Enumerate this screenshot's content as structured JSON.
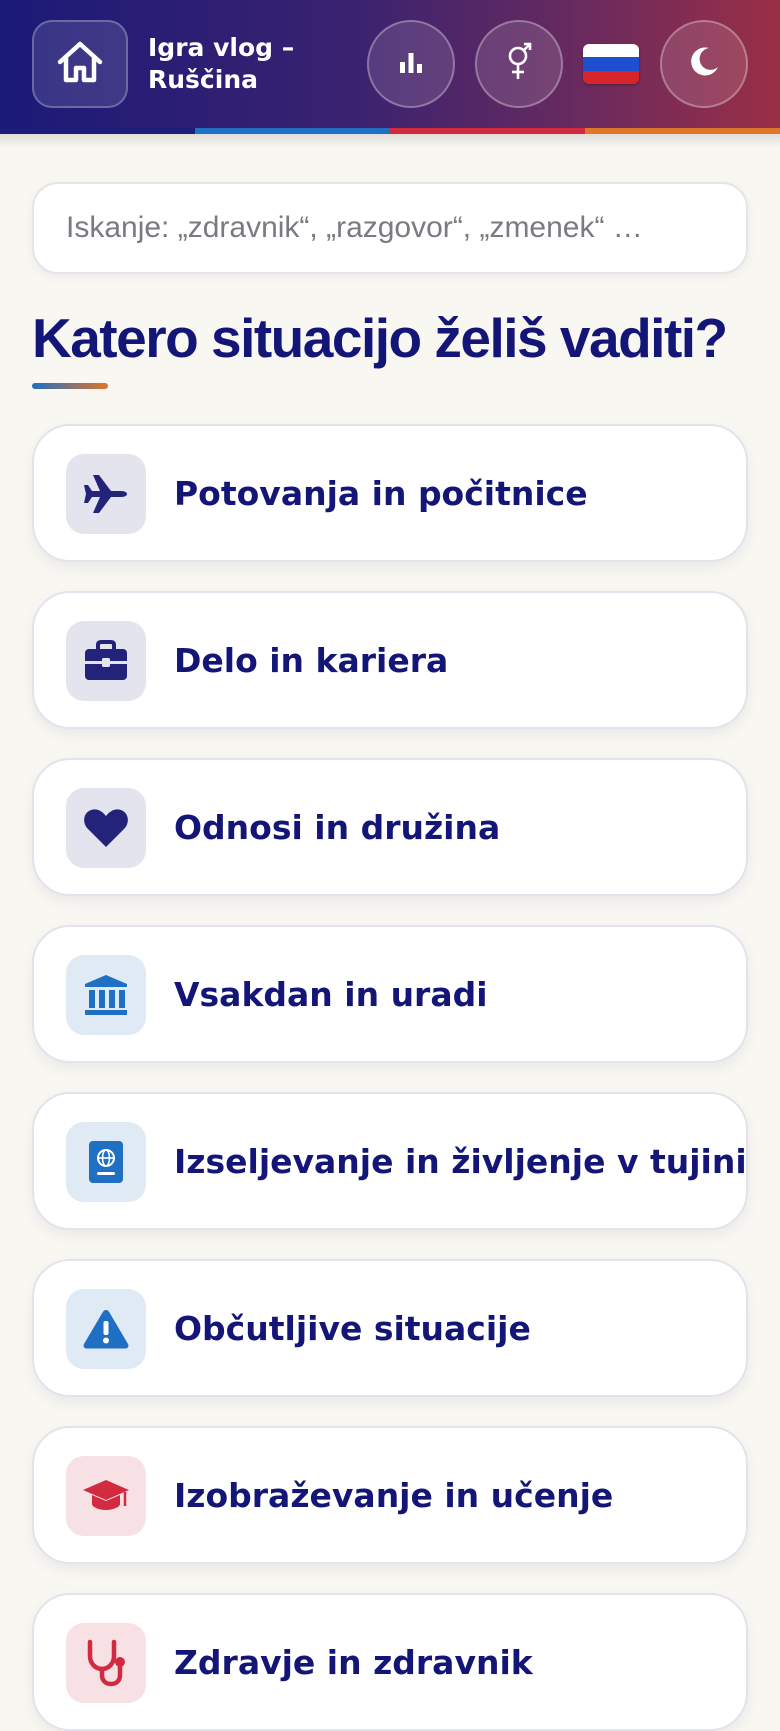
{
  "header": {
    "title": "Igra vlog – Ruščina",
    "buttons": {
      "home": "home-icon",
      "stats": "bar-chart-icon",
      "gender": "gender-icon",
      "language_flag": "russia-flag-icon",
      "theme": "moon-icon"
    },
    "stripe_colors": [
      "#1f1d7a",
      "#1f6fc2",
      "#d22b3f",
      "#e1762b"
    ]
  },
  "search": {
    "placeholder": "Iskanje: „zdravnik“, „razgovor“, „zmenek“ …",
    "value": ""
  },
  "main": {
    "heading": "Katero situacijo želiš vaditi?",
    "categories": [
      {
        "label": "Potovanja in počitnice",
        "icon": "airplane-icon",
        "icon_color": "#23237a",
        "icon_bg": "#e4e4ef"
      },
      {
        "label": "Delo in kariera",
        "icon": "briefcase-icon",
        "icon_color": "#23237a",
        "icon_bg": "#e4e4ef"
      },
      {
        "label": "Odnosi in družina",
        "icon": "heart-icon",
        "icon_color": "#23237a",
        "icon_bg": "#e4e4ef"
      },
      {
        "label": "Vsakdan in uradi",
        "icon": "bank-icon",
        "icon_color": "#1f6fc2",
        "icon_bg": "#dfeaf5"
      },
      {
        "label": "Izseljevanje in življenje v tujini",
        "icon": "passport-icon",
        "icon_color": "#1f6fc2",
        "icon_bg": "#dfeaf5"
      },
      {
        "label": "Občutljive situacije",
        "icon": "warning-icon",
        "icon_color": "#1f6fc2",
        "icon_bg": "#dfeaf5"
      },
      {
        "label": "Izobraževanje in učenje",
        "icon": "graduation-cap-icon",
        "icon_color": "#d22b3f",
        "icon_bg": "#f8e1e4"
      },
      {
        "label": "Zdravje in zdravnik",
        "icon": "stethoscope-icon",
        "icon_color": "#d22b3f",
        "icon_bg": "#f8e1e4"
      }
    ]
  }
}
